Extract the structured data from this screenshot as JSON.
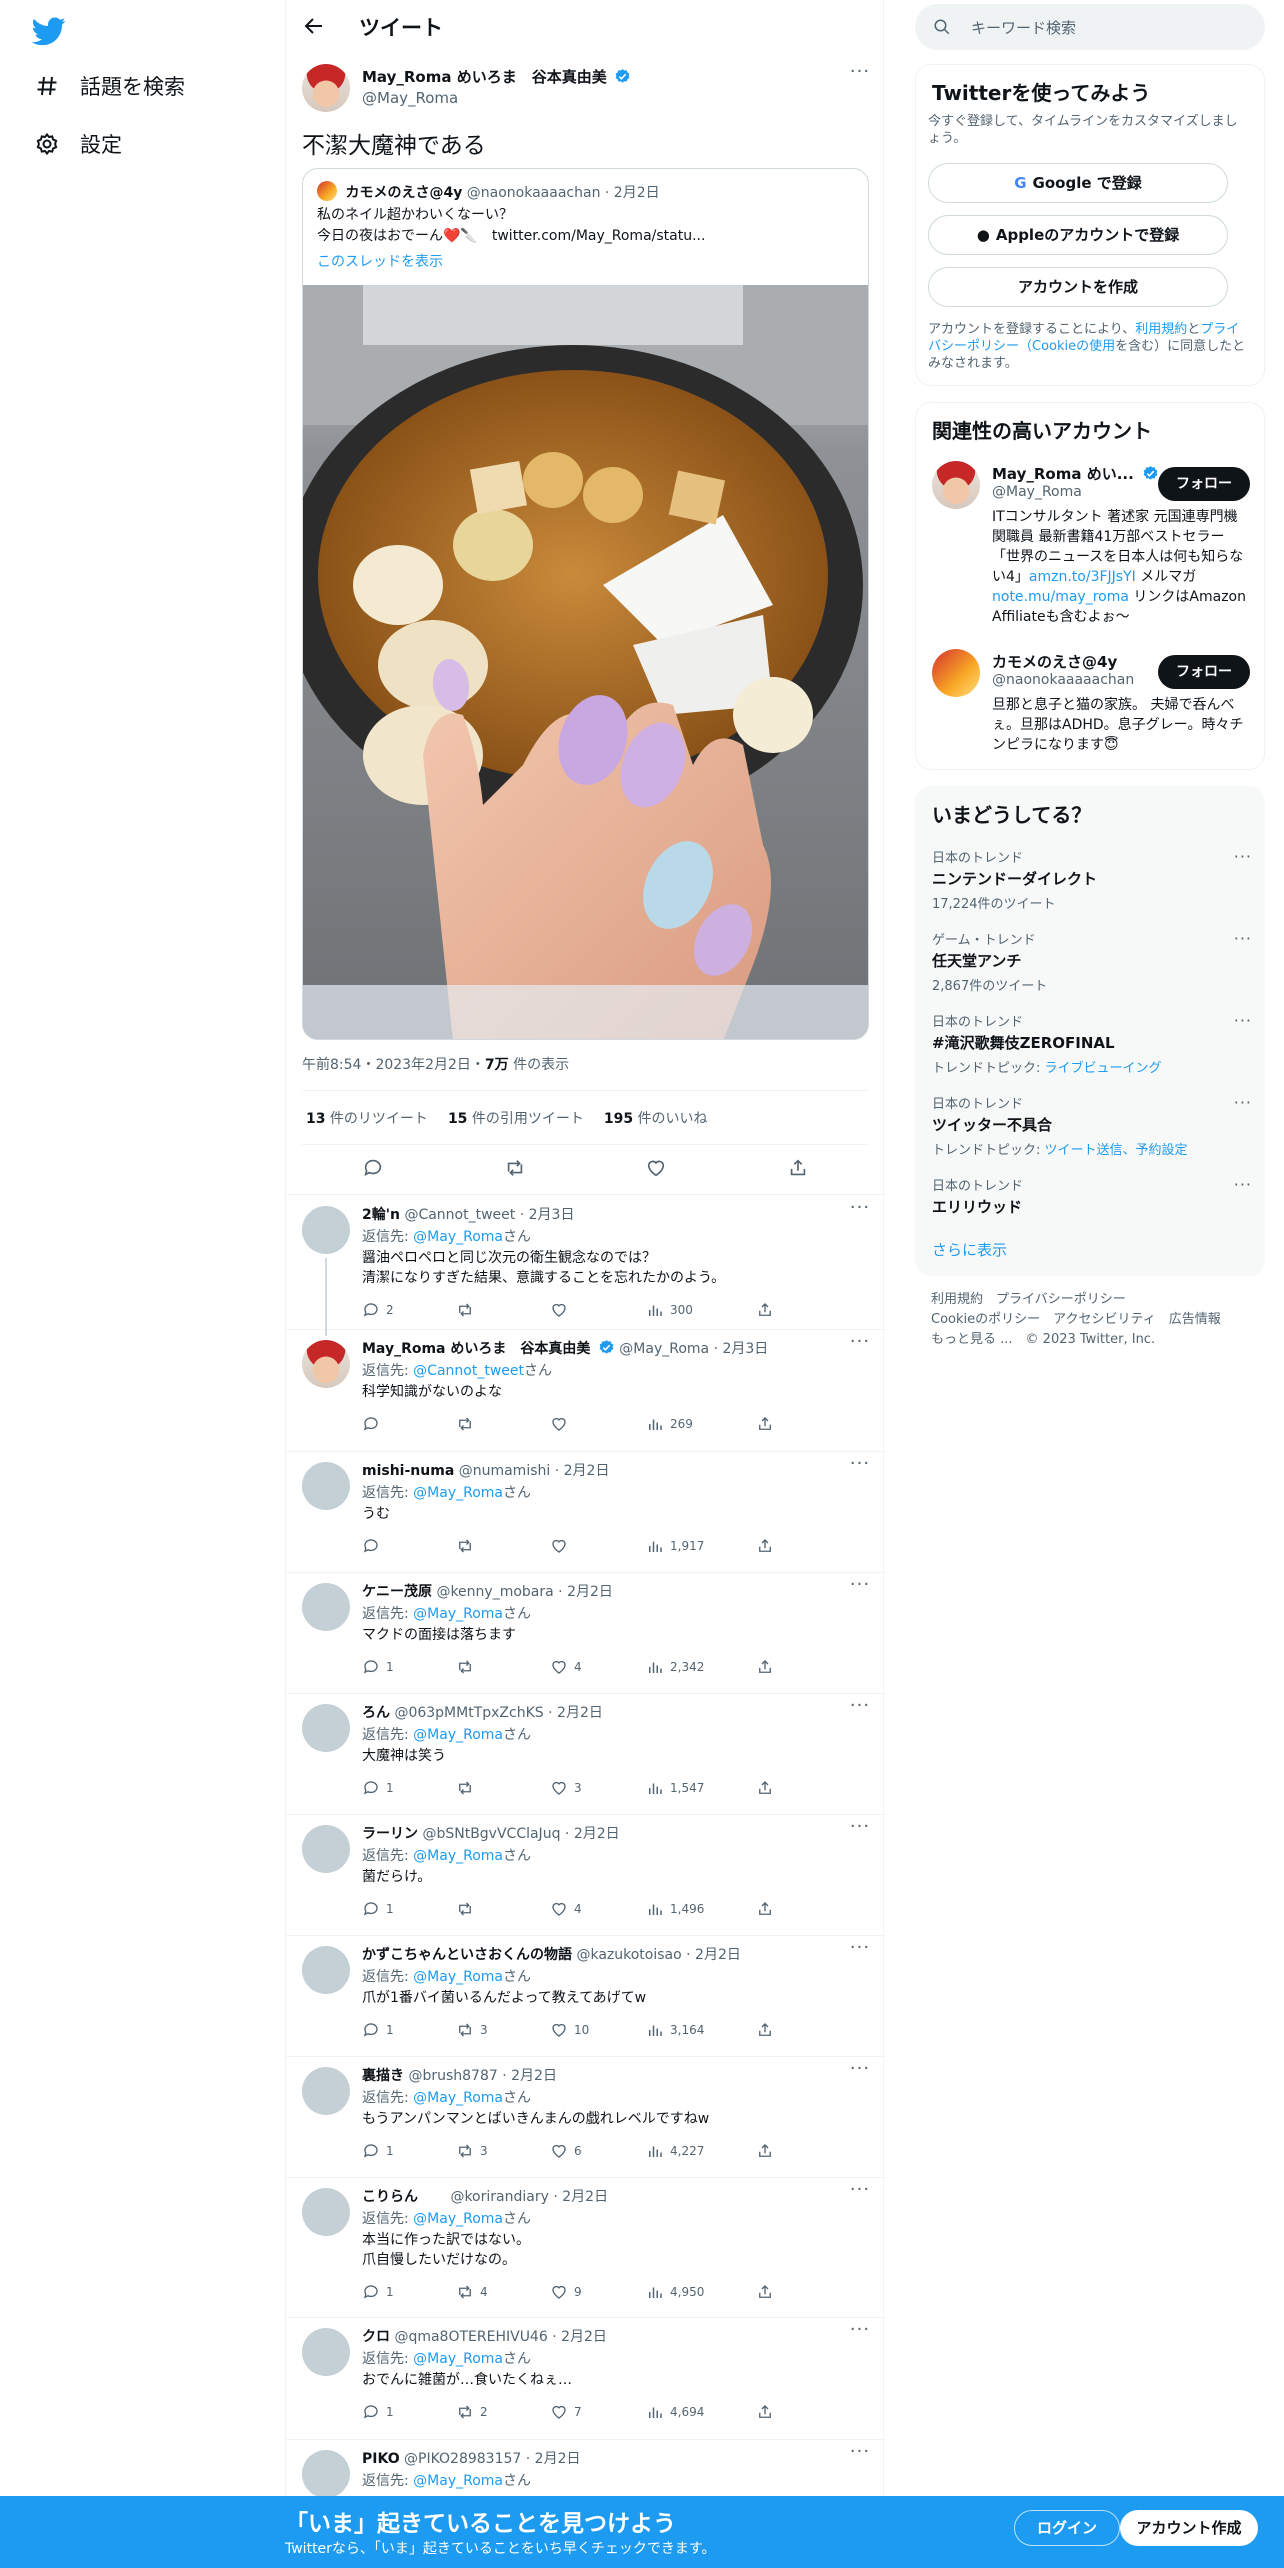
{
  "sidebar": {
    "items": [
      {
        "label": "話題を検索"
      },
      {
        "label": "設定"
      }
    ]
  },
  "header": {
    "title": "ツイート"
  },
  "main_tweet": {
    "name": "May_Roma めいろま　谷本真由美",
    "handle": "@May_Roma",
    "text": "不潔大魔神である",
    "quote": {
      "name": "カモメのえさ@4y",
      "handle": "@naonokaaaachan",
      "date": "2月2日",
      "text_line1": "私のネイル超かわいくなーい？",
      "text_line2": "今日の夜はおでーん❤️🔪　twitter.com/May_Roma/statu...",
      "thread_link": "このスレッドを表示"
    },
    "meta": {
      "time": "午前8:54・2023年2月2日・",
      "views": "7万",
      "views_label": " 件の表示"
    },
    "stats": {
      "retweets": "13",
      "retweets_label": " 件のリツイート",
      "quotes": "15",
      "quotes_label": " 件の引用ツイート",
      "likes": "195",
      "likes_label": " 件のいいね"
    }
  },
  "reply_to_label": "返信先: ",
  "reply_to_suffix": "さん",
  "replies": [
    {
      "name": "2輪'n",
      "handle": "@Cannot_tweet",
      "date": "2月3日",
      "to": "@May_Roma",
      "text": "醤油ペロペロと同じ次元の衛生観念なのでは？\n清潔になりすぎた結果、意識することを忘れたかのよう。",
      "replies": "2",
      "retweets": "",
      "likes": "",
      "views": "300"
    },
    {
      "name": "May_Roma めいろま　谷本真由美",
      "handle": "@May_Roma",
      "date": "2月3日",
      "to": "@Cannot_tweet",
      "text": "科学知識がないのよな",
      "replies": "",
      "retweets": "",
      "likes": "",
      "views": "269"
    },
    {
      "name": "mishi-numa",
      "handle": "@numamishi",
      "date": "2月2日",
      "to": "@May_Roma",
      "text": "うむ",
      "replies": "",
      "retweets": "",
      "likes": "",
      "views": "1,917"
    },
    {
      "name": "ケニー茂原",
      "handle": "@kenny_mobara",
      "date": "2月2日",
      "to": "@May_Roma",
      "text": "マクドの面接は落ちます",
      "replies": "1",
      "retweets": "",
      "likes": "4",
      "views": "2,342"
    },
    {
      "name": "ろん",
      "handle": "@063pMMtTpxZchKS",
      "date": "2月2日",
      "to": "@May_Roma",
      "text": "大魔神は笑う",
      "replies": "1",
      "retweets": "",
      "likes": "3",
      "views": "1,547"
    },
    {
      "name": "ラーリン",
      "handle": "@bSNtBgvVCClaJuq",
      "date": "2月2日",
      "to": "@May_Roma",
      "text": "菌だらけ。",
      "replies": "1",
      "retweets": "",
      "likes": "4",
      "views": "1,496"
    },
    {
      "name": "かずこちゃんといさおくんの物語",
      "handle": "@kazukotoisao",
      "date": "2月2日",
      "to": "@May_Roma",
      "text": "爪が1番バイ菌いるんだよって教えてあげてw",
      "replies": "1",
      "retweets": "3",
      "likes": "10",
      "views": "3,164"
    },
    {
      "name": "裏描き",
      "handle": "@brush8787",
      "date": "2月2日",
      "to": "@May_Roma",
      "text": "もうアンパンマンとばいきんまんの戯れレベルですねw",
      "replies": "1",
      "retweets": "3",
      "likes": "6",
      "views": "4,227"
    },
    {
      "name": "こりらん　　",
      "handle": "@korirandiary",
      "date": "2月2日",
      "to": "@May_Roma",
      "text": "本当に作った訳ではない。\n爪自慢したいだけなの。",
      "replies": "1",
      "retweets": "4",
      "likes": "9",
      "views": "4,950"
    },
    {
      "name": "クロ",
      "handle": "@qma8OTEREHIVU46",
      "date": "2月2日",
      "to": "@May_Roma",
      "text": "おでんに雑菌が…食いたくねぇ…",
      "replies": "1",
      "retweets": "2",
      "likes": "7",
      "views": "4,694"
    },
    {
      "name": "PIKO",
      "handle": "@PIKO28983157",
      "date": "2月2日",
      "to": "@May_Roma",
      "text": "",
      "replies": "",
      "retweets": "",
      "likes": "",
      "views": ""
    }
  ],
  "right": {
    "search_placeholder": "キーワード検索",
    "signup": {
      "title": "Twitterを使ってみよう",
      "desc": "今すぐ登録して、タイムラインをカスタマイズしましょう。",
      "google": "Google で登録",
      "apple": "Appleのアカウントで登録",
      "create": "アカウントを作成",
      "terms_pre": "アカウントを登録することにより、",
      "terms_link1": "利用規約",
      "terms_mid": "と",
      "terms_link2": "プライバシーポリシー（Cookieの使用",
      "terms_post": "を含む）に同意したとみなされます。"
    },
    "related": {
      "title": "関連性の高いアカウント",
      "accounts": [
        {
          "name": "May_Roma めい...",
          "handle": "@May_Roma",
          "follow": "フォロー",
          "bio1": "ITコンサルタント 著述家 元国連専門機関職員 最新書籍41万部ベストセラー「世界のニュースを日本人は何も知らない4」",
          "bio_link1": "amzn.to/3FJJsYI",
          "bio2": " メルマガ",
          "bio_link2": "note.mu/may_roma",
          "bio3": " リンクはAmazon Affiliateも含むよぉ〜"
        },
        {
          "name": "カモメのえさ@4y",
          "handle": "@naonokaaaaachan",
          "follow": "フォロー",
          "bio1": "旦那と息子と猫の家族。 夫婦で呑んべぇ。旦那はADHD。息子グレー。時々チンピラになります😇"
        }
      ]
    },
    "trends": {
      "title": "いまどうしてる？",
      "items": [
        {
          "cat": "日本のトレンド",
          "name": "ニンテンドーダイレクト",
          "sub": "17,224件のツイート"
        },
        {
          "cat": "ゲーム・トレンド",
          "name": "任天堂アンチ",
          "sub": "2,867件のツイート"
        },
        {
          "cat": "日本のトレンド",
          "name": "#滝沢歌舞伎ZEROFINAL",
          "sub": "トレンドトピック: ",
          "sub_link": "ライブビューイング"
        },
        {
          "cat": "日本のトレンド",
          "name": "ツイッター不具合",
          "sub": "トレンドトピック: ",
          "sub_link": "ツイート送信、予約設定"
        },
        {
          "cat": "日本のトレンド",
          "name": "エリリウッド",
          "sub": ""
        }
      ],
      "more": "さらに表示"
    },
    "footer": {
      "l1a": "利用規約",
      "l1b": "プライバシーポリシー",
      "l2a": "Cookieのポリシー",
      "l2b": "アクセシビリティ",
      "l2c": "広告情報",
      "l3a": "もっと見る ...",
      "l3b": "© 2023 Twitter, Inc."
    }
  },
  "bottom": {
    "title": "「いま」起きていることを見つけよう",
    "sub": "Twitterなら、「いま」起きていることをいち早くチェックできます。",
    "login": "ログイン",
    "signup": "アカウント作成"
  },
  "colors": {
    "accent": "#1d9bf0",
    "text": "#0f1419",
    "muted": "#536471",
    "border": "#eff3f4"
  }
}
